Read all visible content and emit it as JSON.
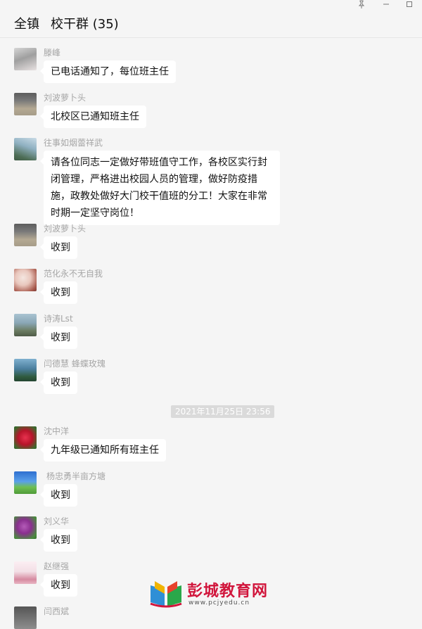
{
  "window": {
    "title_group": "全镇",
    "title_name": "校干群 (35)",
    "controls": {
      "pin_icon": "pin-icon",
      "minimize_icon": "minimize-icon",
      "maximize_icon": "maximize-icon"
    }
  },
  "messages": [
    {
      "sender": "滕峰",
      "text": "已电话通知了，每位班主任",
      "avatar_colors": [
        "#b6b6b6",
        "#e1dede"
      ]
    },
    {
      "sender": "刘波萝卜头",
      "text": "北校区已通知班主任",
      "avatar_colors": [
        "#6e6e6e",
        "#b4a993"
      ]
    },
    {
      "sender": "往事如烟蕾祥武",
      "text": "请各位同志一定做好带班值守工作，各校区实行封闭管理，严格进出校园人员的管理，做好防疫措施，政教处做好大门校干值班的分工！大家在非常时期一定坚守岗位！",
      "avatar_colors": [
        "#9bb6c8",
        "#4d6d55"
      ]
    },
    {
      "sender": "刘波萝卜头",
      "text": "收到",
      "avatar_colors": [
        "#6e6e6e",
        "#b4a993"
      ]
    },
    {
      "sender": "范化永不无自我",
      "text": "收到",
      "avatar_colors": [
        "#f0d9d0",
        "#a95b4e"
      ]
    },
    {
      "sender": "诗涛Lst",
      "text": "收到",
      "avatar_colors": [
        "#8aa7b6",
        "#5b6b52"
      ]
    },
    {
      "sender": "闫德慧  蜂蝶玫瑰",
      "text": "收到",
      "avatar_colors": [
        "#4a7e9d",
        "#2f5a3d"
      ]
    },
    {
      "sender": "沈中洋",
      "text": "九年级已通知所有班主任",
      "avatar_colors": [
        "#b7142a",
        "#3c6b2e"
      ]
    },
    {
      "sender": "杨忠勇半亩方塘",
      "text": "收到",
      "avatar_colors": [
        "#3b7fd3",
        "#6fbf52"
      ]
    },
    {
      "sender": "刘义华",
      "text": "收到",
      "avatar_colors": [
        "#8a2f8f",
        "#4a8b3e"
      ]
    },
    {
      "sender": "赵继强",
      "text": "收到",
      "avatar_colors": [
        "#f3dfe6",
        "#d68aa0"
      ]
    },
    {
      "sender": "闫西斌",
      "text": "",
      "avatar_colors": [
        "#666666",
        "#9e9e9e"
      ]
    }
  ],
  "timestamp": "2021年11月25日 23:56",
  "watermark": {
    "text": "彭城教育网",
    "url": "www.pcjyedu.cn"
  }
}
